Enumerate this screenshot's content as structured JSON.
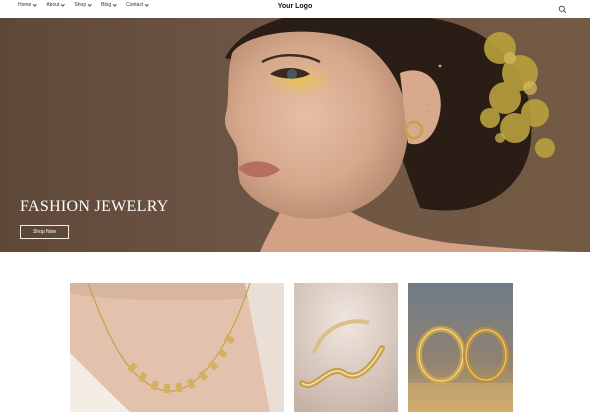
{
  "header": {
    "nav": [
      {
        "label": "Home"
      },
      {
        "label": "About"
      },
      {
        "label": "Shop"
      },
      {
        "label": "Blog"
      },
      {
        "label": "Contact"
      }
    ],
    "logo": "Your Logo",
    "search_icon": "search-icon"
  },
  "hero": {
    "title": "FASHION JEWELRY",
    "button": "Shop Now",
    "image": "woman-with-gold-glitter-makeup-and-hoop-earrings"
  },
  "products": [
    {
      "image": "gold-bar-necklace"
    },
    {
      "image": "gold-wave-cuff-bracelet"
    },
    {
      "image": "gold-wedding-rings-pair"
    }
  ],
  "colors": {
    "hero_background": "#6c5442",
    "accent_gold": "#c9a14a"
  }
}
